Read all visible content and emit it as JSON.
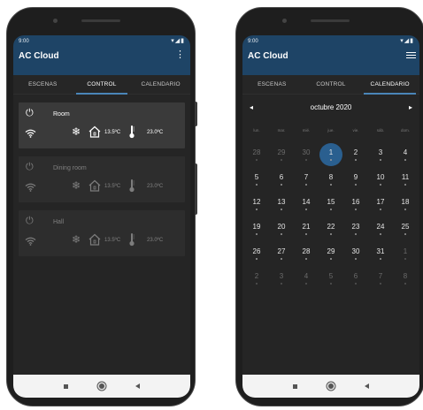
{
  "left_phone": {
    "status_time": "9:00",
    "status_icons": "▾◢▮",
    "app_title": "AC Cloud",
    "tabs": [
      "ESCENAS",
      "CONTROL",
      "CALENDARIO"
    ],
    "active_tab": "CONTROL",
    "devices": [
      {
        "name": "Room",
        "temp_inside": "13.5ºC",
        "temp_outside": "23.0ºC",
        "enabled": true
      },
      {
        "name": "Dining room",
        "temp_inside": "13.5ºC",
        "temp_outside": "23.0ºC",
        "enabled": false
      },
      {
        "name": "Hall",
        "temp_inside": "13.5ºC",
        "temp_outside": "23.0ºC",
        "enabled": false
      }
    ]
  },
  "right_phone": {
    "status_time": "9:00",
    "status_icons": "▾◢▮",
    "app_title": "AC Cloud",
    "tabs": [
      "ESCENAS",
      "CONTROL",
      "CALENDARIO"
    ],
    "active_tab": "CALENDARIO",
    "calendar": {
      "month_label": "octubre 2020",
      "prev_glyph": "◂",
      "next_glyph": "▸",
      "weekdays": [
        "lun.",
        "mar.",
        "mié.",
        "jue.",
        "vie.",
        "sáb.",
        "dom."
      ],
      "selected_day": "1",
      "weeks": [
        [
          {
            "d": "28",
            "other": true
          },
          {
            "d": "29",
            "other": true
          },
          {
            "d": "30",
            "other": true
          },
          {
            "d": "1",
            "other": false
          },
          {
            "d": "2",
            "other": false
          },
          {
            "d": "3",
            "other": false
          },
          {
            "d": "4",
            "other": false
          }
        ],
        [
          {
            "d": "5",
            "other": false
          },
          {
            "d": "6",
            "other": false
          },
          {
            "d": "7",
            "other": false
          },
          {
            "d": "8",
            "other": false
          },
          {
            "d": "9",
            "other": false
          },
          {
            "d": "10",
            "other": false
          },
          {
            "d": "11",
            "other": false
          }
        ],
        [
          {
            "d": "12",
            "other": false
          },
          {
            "d": "13",
            "other": false
          },
          {
            "d": "14",
            "other": false
          },
          {
            "d": "15",
            "other": false
          },
          {
            "d": "16",
            "other": false
          },
          {
            "d": "17",
            "other": false
          },
          {
            "d": "18",
            "other": false
          }
        ],
        [
          {
            "d": "19",
            "other": false
          },
          {
            "d": "20",
            "other": false
          },
          {
            "d": "21",
            "other": false
          },
          {
            "d": "22",
            "other": false
          },
          {
            "d": "23",
            "other": false
          },
          {
            "d": "24",
            "other": false
          },
          {
            "d": "25",
            "other": false
          }
        ],
        [
          {
            "d": "26",
            "other": false
          },
          {
            "d": "27",
            "other": false
          },
          {
            "d": "28",
            "other": false
          },
          {
            "d": "29",
            "other": false
          },
          {
            "d": "30",
            "other": false
          },
          {
            "d": "31",
            "other": false
          },
          {
            "d": "1",
            "other": true
          }
        ],
        [
          {
            "d": "2",
            "other": true
          },
          {
            "d": "3",
            "other": true
          },
          {
            "d": "4",
            "other": true
          },
          {
            "d": "5",
            "other": true
          },
          {
            "d": "6",
            "other": true
          },
          {
            "d": "7",
            "other": true
          },
          {
            "d": "8",
            "other": true
          }
        ]
      ]
    }
  },
  "icons": {
    "power": "power-icon",
    "wifi": "wifi-icon",
    "snow": "snowflake-icon",
    "house": "house-icon",
    "thermometer": "thermometer-icon",
    "menu": "overflow-menu-icon",
    "list": "list-icon"
  },
  "colors": {
    "appbar": "#1e4466",
    "accent": "#4a86b8",
    "selected_day": "#2a5f8f",
    "card": "#3a3a3a",
    "screen_bg": "#252525"
  }
}
